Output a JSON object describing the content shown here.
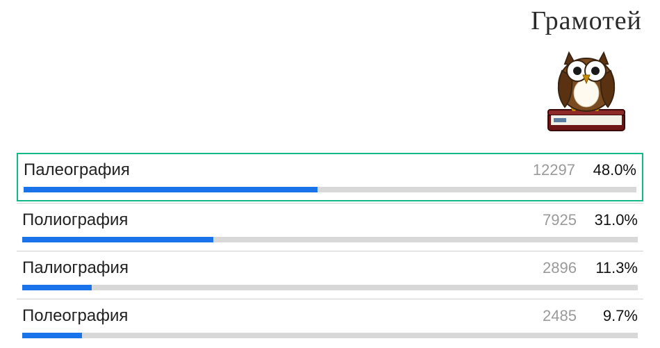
{
  "app": {
    "title": "Грамотей"
  },
  "chart_data": {
    "type": "bar",
    "title": "",
    "xlabel": "",
    "ylabel": "",
    "ylim": [
      0,
      100
    ],
    "series": [
      {
        "name": "Палеография",
        "count": 12297,
        "percent": 48.0,
        "correct": true
      },
      {
        "name": "Полиография",
        "count": 7925,
        "percent": 31.0,
        "correct": false
      },
      {
        "name": "Палиография",
        "count": 2896,
        "percent": 11.3,
        "correct": false
      },
      {
        "name": "Полеография",
        "count": 2485,
        "percent": 9.7,
        "correct": false
      }
    ]
  }
}
